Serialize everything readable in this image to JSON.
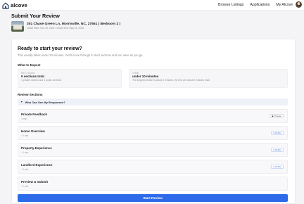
{
  "nav": {
    "logo_text": "alcove",
    "links": [
      "Browse Listings",
      "Applications",
      "My Alcove"
    ]
  },
  "header": {
    "title": "Submit Your Review",
    "property_address": "301 Chase Green Ln, Morrisville, NC, 27561 ( Bedroom 2 )",
    "lease_dates": "Lease Start: Nov 26, 2024 • Lease End: May 26, 2026"
  },
  "intro": {
    "title": "Ready to start your review?",
    "subtitle": "This usually takes under 10 minutes. You'll move through 6 short sections and can save as you go."
  },
  "expect": {
    "label": "What to Expect",
    "sections_head": "SECTIONS",
    "sections_main": "5 sections total",
    "sections_note": "1 private section and 4 public sections",
    "time_head": "TIME",
    "time_main": "under 10 minutes",
    "time_note": "The longest section is about 3 minutes, the rest are about 2 minutes each."
  },
  "review_sections": {
    "label": "Review Sections",
    "who_label": "Who Can See My Responses?",
    "items": [
      {
        "title": "Private Feedback",
        "time": "3 min",
        "badge": "Private"
      },
      {
        "title": "Home Overview",
        "time": "~2 min",
        "badge": "Public"
      },
      {
        "title": "Property Experience",
        "time": "~2 min",
        "badge": "Public"
      },
      {
        "title": "Landlord Experience",
        "time": "~2 min",
        "badge": "Public"
      },
      {
        "title": "Preview & Submit",
        "time": "~1 min",
        "badge": ""
      }
    ]
  },
  "start_button": "Start Review",
  "colors": {
    "accent": "#2d6bea",
    "public_badge": "#3b6fd9"
  },
  "icons": {
    "logo": "house-icon",
    "chevron": "chevron-down-icon",
    "lock": "lock-icon",
    "globe": "globe-icon"
  }
}
